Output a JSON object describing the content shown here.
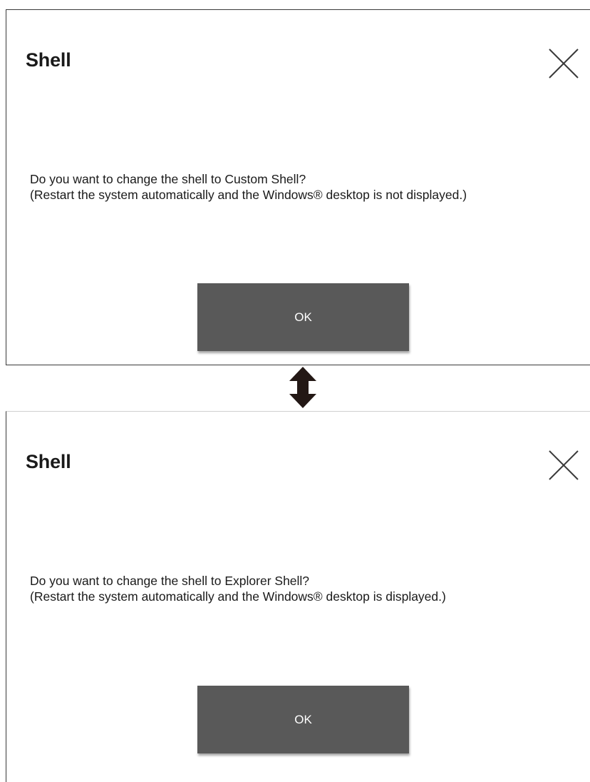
{
  "dialogs": [
    {
      "title": "Shell",
      "message_line1": "Do you want to change the shell to Custom Shell?",
      "message_line2": "(Restart the system automatically and the Windows® desktop is not displayed.)",
      "ok_label": "OK",
      "close_icon": "close-icon"
    },
    {
      "title": "Shell",
      "message_line1": "Do you want to change the shell to Explorer Shell?",
      "message_line2": "(Restart the system automatically and the Windows® desktop is displayed.)",
      "ok_label": "OK",
      "close_icon": "close-icon"
    }
  ],
  "connector_icon": "up-down-arrow-icon",
  "colors": {
    "button_bg": "#595959",
    "button_text": "#ffffff",
    "text": "#1a1a1a",
    "arrow": "#231815"
  }
}
